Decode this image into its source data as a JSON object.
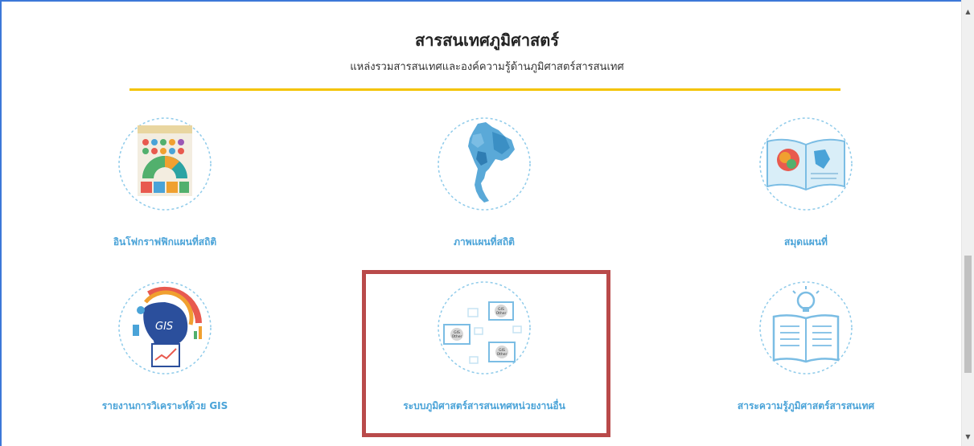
{
  "section": {
    "title": "สารสนเทศภูมิศาสตร์",
    "subtitle": "แหล่งรวมสารสนเทศและองค์ความรู้ด้านภูมิศาสตร์สารสนเทศ"
  },
  "cards": [
    {
      "label": "อินโฟกราฟฟิกแผนที่สถิติ",
      "icon": "infographic-icon"
    },
    {
      "label": "ภาพแผนที่สถิติ",
      "icon": "thailand-map-icon"
    },
    {
      "label": "สมุดแผนที่",
      "icon": "atlas-book-icon"
    },
    {
      "label": "รายงานการวิเคราะห์ด้วย GIS",
      "icon": "gis-analysis-icon"
    },
    {
      "label": "ระบบภูมิศาสตร์สารสนเทศหน่วยงานอื่น",
      "icon": "gis-other-systems-icon"
    },
    {
      "label": "สาระความรู้ภูมิศาสตร์สารสนเทศ",
      "icon": "knowledge-book-icon"
    }
  ],
  "gis_icon_text": {
    "gis": "GIS",
    "other": "Other"
  },
  "colors": {
    "accent_line": "#f4c300",
    "label": "#4aa3d8",
    "highlight": "#b94a4a",
    "circle": "#8fcbea"
  }
}
